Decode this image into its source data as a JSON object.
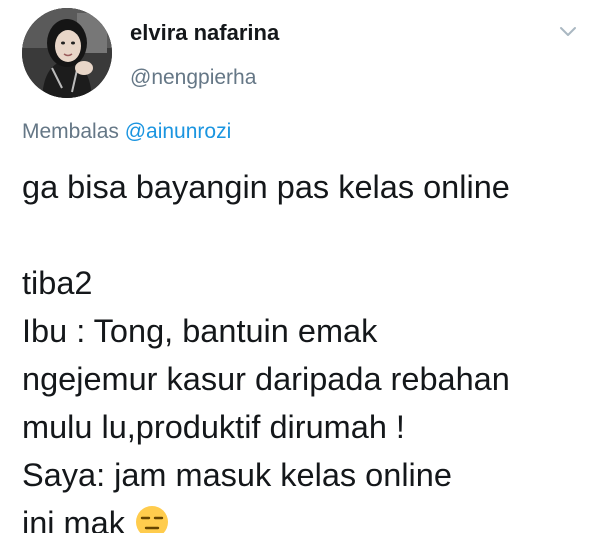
{
  "tweet": {
    "display_name": "elvira nafarina",
    "handle": "@nengpierha",
    "reply_prefix": "Membalas",
    "reply_mention": "@ainunrozi",
    "lines": [
      "ga bisa bayangin pas kelas online",
      "",
      "tiba2",
      "Ibu : Tong, bantuin emak",
      "ngejemur kasur daripada rebahan",
      "mulu lu,produktif dirumah !",
      "Saya: jam masuk kelas online",
      "ini mak"
    ],
    "emoji": "expressionless-face",
    "avatar": "profile-photo"
  },
  "colors": {
    "text": "#14171a",
    "secondary": "#657786",
    "link": "#1b95e0",
    "emoji": "#ffcc4d"
  },
  "icons": {
    "menu": "chevron-down-icon"
  }
}
